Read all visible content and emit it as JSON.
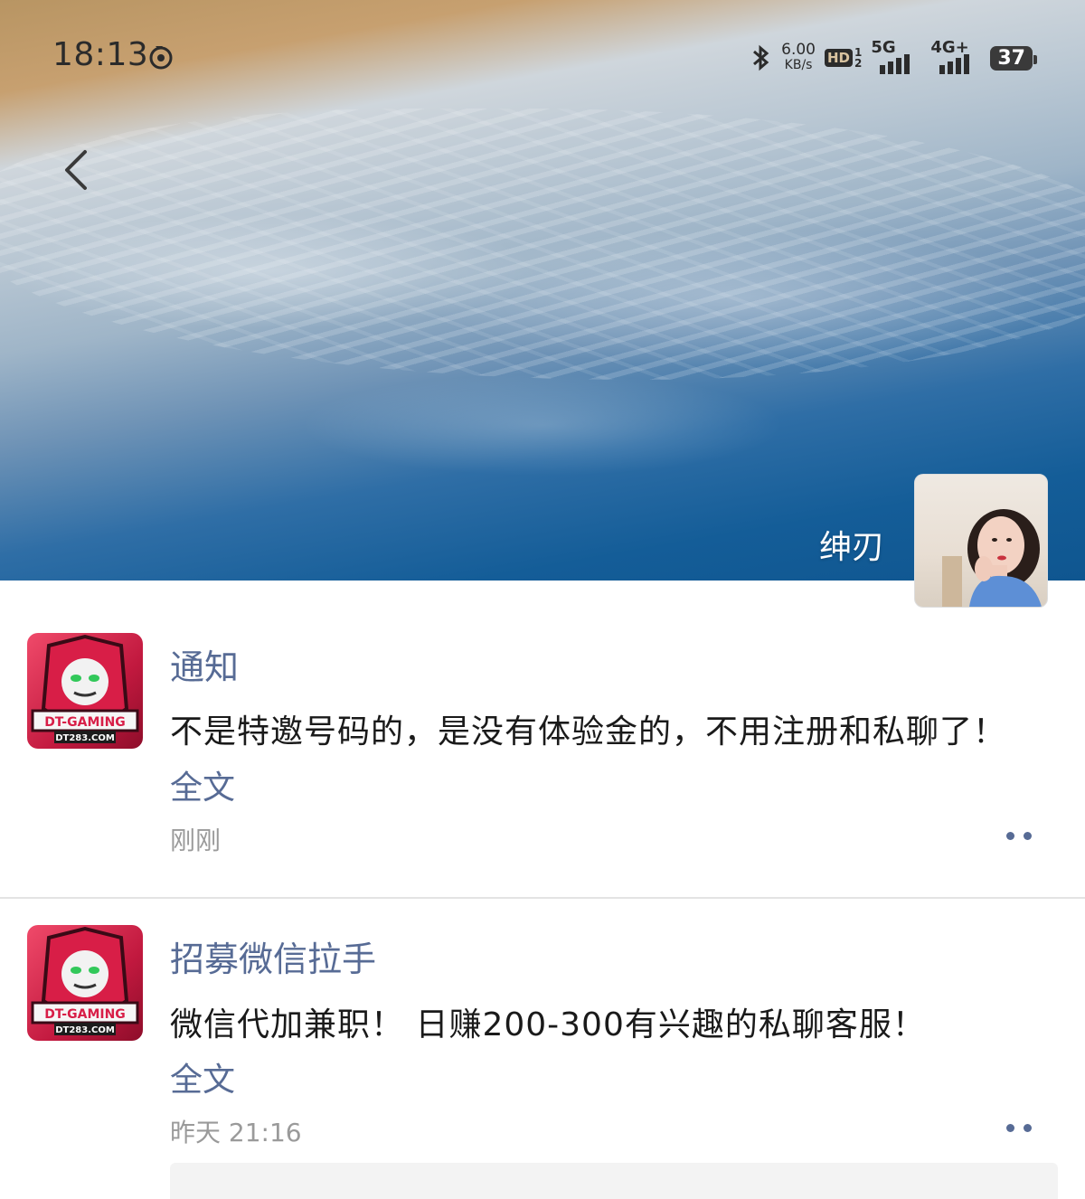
{
  "status_bar": {
    "time": "18:13",
    "net_speed_value": "6.00",
    "net_speed_unit": "KB/s",
    "hd_label": "HD",
    "hd_sub_1": "1",
    "hd_sub_2": "2",
    "network_1": "5G",
    "network_2": "4G+",
    "battery": "37"
  },
  "header": {
    "profile_name": "绅刃"
  },
  "posts": [
    {
      "author": "通知",
      "text": "不是特邀号码的，是没有体验金的，不用注册和私聊了！",
      "full_text_link": "全文",
      "time": "刚刚",
      "avatar_brand": "DT-GAMING",
      "avatar_site": "DT283.COM"
    },
    {
      "author": "招募微信拉手",
      "text": "微信代加兼职！ 日赚200-300有兴趣的私聊客服！",
      "full_text_link": "全文",
      "time": "昨天 21:16",
      "avatar_brand": "DT-GAMING",
      "avatar_site": "DT283.COM"
    }
  ],
  "colors": {
    "link": "#576b95",
    "text": "#1a1a1a",
    "meta": "#9a9a9a",
    "avatar_red": "#c2193f"
  }
}
